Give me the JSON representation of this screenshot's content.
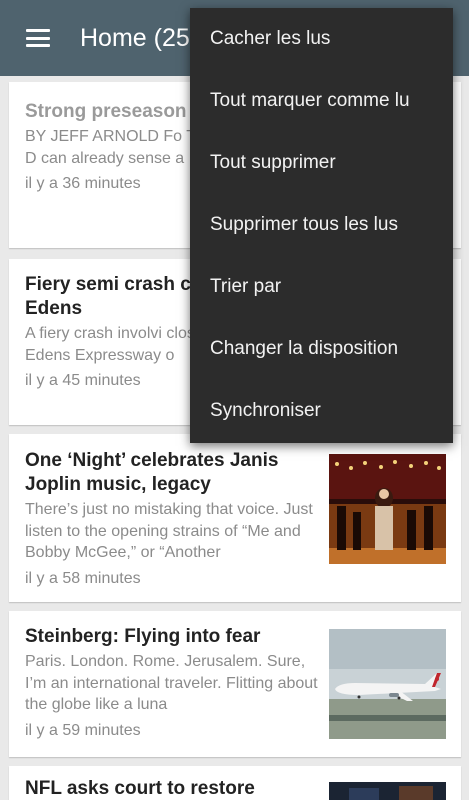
{
  "appbar": {
    "title": "Home (25"
  },
  "menu": {
    "items": [
      "Cacher les lus",
      "Tout marquer comme lu",
      "Tout supprimer",
      "Supprimer tous les lus",
      "Trier par",
      "Changer la disposition",
      "Synchroniser"
    ]
  },
  "articles": [
    {
      "title": "Strong preseason hopes",
      "summary": "BY JEFF ARNOLD Fo Times Fire forward D can already sense a",
      "time": "il y a 36 minutes",
      "read": true
    },
    {
      "title": "Fiery semi crash c eastbound Edens",
      "summary": "A fiery crash involvi closed all eastbound Edens Expressway o",
      "time": "il y a 45 minutes",
      "read": false
    },
    {
      "title": "One ‘Night’ celebrates Janis Joplin music, legacy",
      "summary": "There’s just no mistaking that voice. Just listen to the opening strains of “Me and Bobby McGee,” or “Another",
      "time": "il y a 58 minutes",
      "read": false,
      "thumbnail": "concert-stage-photo"
    },
    {
      "title": "Steinberg: Flying into fear",
      "summary": "Paris. London. Rome. Jerusalem. Sure, I’m an international traveler. Flitting about the globe like a luna",
      "time": "il y a 59 minutes",
      "read": false,
      "thumbnail": "airplane-photo"
    },
    {
      "title": "NFL asks court to restore",
      "read": false,
      "thumbnail": "football-photo"
    }
  ],
  "colors": {
    "appbar": "#4f636e",
    "menu_bg": "#2c2c2c",
    "background": "#e9e9e9"
  }
}
